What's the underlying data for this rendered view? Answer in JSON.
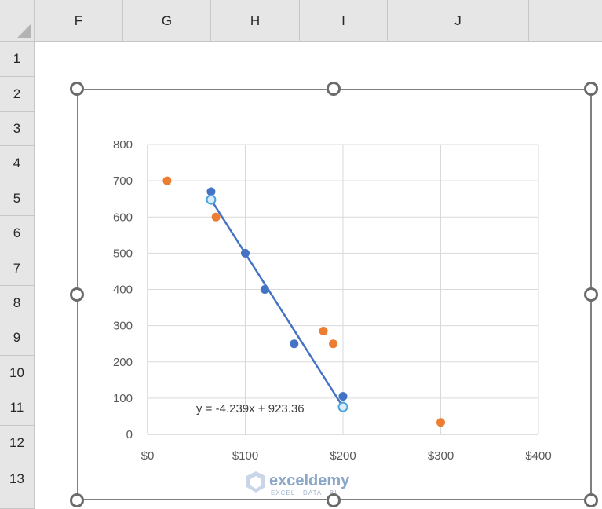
{
  "spreadsheet": {
    "columns": [
      "F",
      "G",
      "H",
      "I",
      "J"
    ],
    "rows": [
      "1",
      "2",
      "3",
      "4",
      "5",
      "6",
      "7",
      "8",
      "9",
      "10",
      "11",
      "12",
      "13"
    ]
  },
  "chart_data": {
    "type": "scatter",
    "xlim": [
      0,
      400
    ],
    "ylim": [
      0,
      800
    ],
    "x_ticks": [
      "$0",
      "$100",
      "$200",
      "$300",
      "$400"
    ],
    "y_ticks": [
      "0",
      "100",
      "200",
      "300",
      "400",
      "500",
      "600",
      "700",
      "800"
    ],
    "grid": true,
    "series": [
      {
        "color": "#4472c4",
        "points": [
          [
            65,
            670
          ],
          [
            100,
            500
          ],
          [
            120,
            400
          ],
          [
            150,
            250
          ],
          [
            200,
            105
          ]
        ]
      },
      {
        "color": "#ed7d31",
        "points": [
          [
            20,
            700
          ],
          [
            70,
            600
          ],
          [
            180,
            285
          ],
          [
            190,
            250
          ],
          [
            300,
            33
          ]
        ]
      }
    ],
    "trendline": {
      "color": "#4472c4",
      "endpoints": [
        [
          65,
          647.8
        ],
        [
          200,
          75.6
        ]
      ],
      "equation": "y = -4.239x + 923.36"
    }
  },
  "watermark": {
    "name": "exceldemy",
    "tagline": "EXCEL · DATA · BI"
  }
}
